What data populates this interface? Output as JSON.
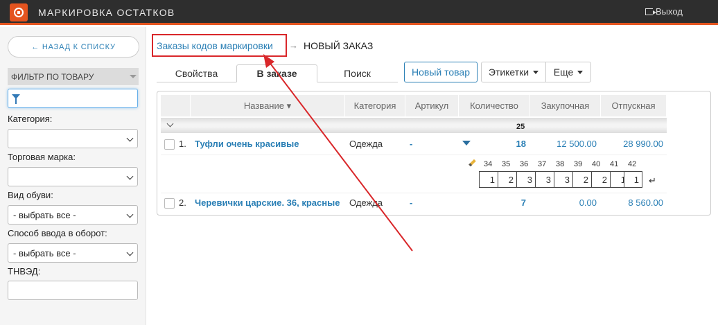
{
  "topbar": {
    "title": "МАРКИРОВКА ОСТАТКОВ",
    "logout": "Выход"
  },
  "sidebar": {
    "back": "← НАЗАД К СПИСКУ",
    "filter_header": "ФИЛЬТР ПО ТОВАРУ",
    "category_label": "Категория:",
    "brand_label": "Торговая марка:",
    "shoe_type_label": "Вид обуви:",
    "shoe_type_value": "- выбрать все -",
    "intro_label": "Способ ввода в оборот:",
    "intro_value": "- выбрать все -",
    "tnved_label": "ТНВЭД:"
  },
  "breadcrumb": {
    "link": "Заказы кодов маркировки",
    "arrow": "→",
    "current": "НОВЫЙ ЗАКАЗ"
  },
  "tabs": [
    "Свойства",
    "В заказе",
    "Поиск"
  ],
  "buttons": {
    "new_item": "Новый товар",
    "labels": "Этикетки",
    "more": "Еще"
  },
  "table": {
    "columns": [
      "Название ▾",
      "Категория",
      "Артикул",
      "Количество",
      "Закупочная",
      "Отпускная"
    ],
    "group_total": "25",
    "rows": [
      {
        "num": "1.",
        "name": "Туфли очень красивые",
        "category": "Одежда",
        "sku": "-",
        "qty": "18",
        "buy": "12 500.00",
        "sell": "28 990.00"
      },
      {
        "num": "2.",
        "name": "Черевички царские. 36, красные",
        "category": "Одежда",
        "sku": "-",
        "qty": "7",
        "buy": "0.00",
        "sell": "8 560.00"
      }
    ],
    "sizes": [
      "34",
      "35",
      "36",
      "37",
      "38",
      "39",
      "40",
      "41",
      "42"
    ],
    "size_qty": [
      "1",
      "2",
      "3",
      "3",
      "3",
      "2",
      "2",
      "1",
      "1"
    ],
    "enter_symbol": "↵"
  },
  "colors": {
    "accent": "#e4541f",
    "link": "#2a7fb5",
    "highlight": "#d9272a"
  }
}
